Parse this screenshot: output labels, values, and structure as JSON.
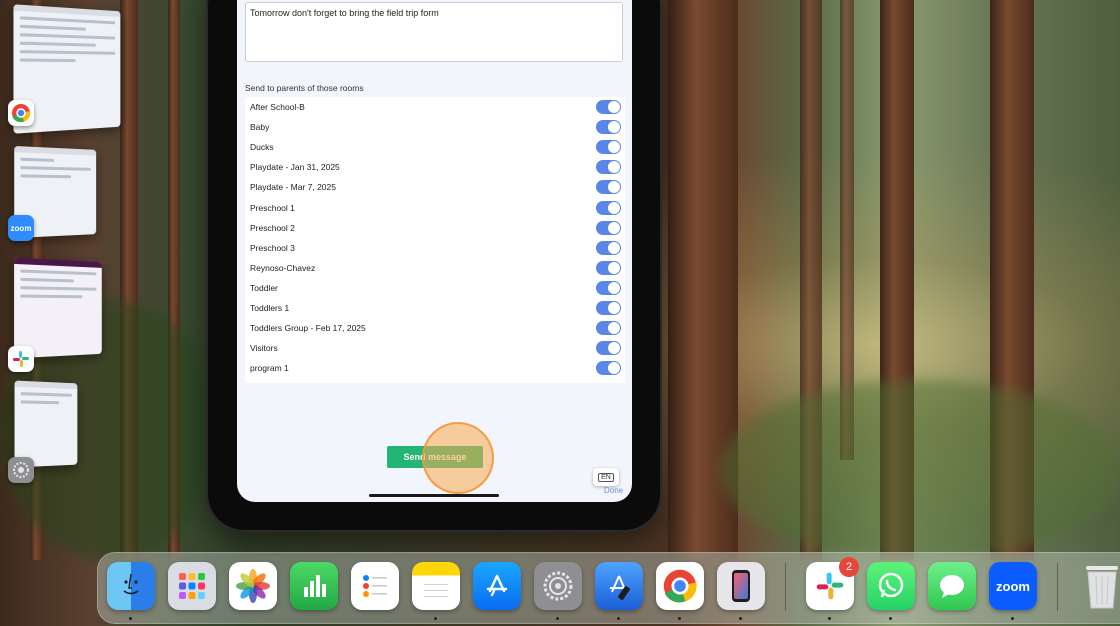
{
  "message": {
    "text": "Tomorrow don't forget to bring the field trip form",
    "section_label": "Send to parents of those rooms"
  },
  "rooms": [
    {
      "label": "After School-B",
      "on": true
    },
    {
      "label": "Baby",
      "on": true
    },
    {
      "label": "Ducks",
      "on": true
    },
    {
      "label": "Playdate - Jan 31, 2025",
      "on": true
    },
    {
      "label": "Playdate - Mar 7, 2025",
      "on": true
    },
    {
      "label": "Preschool 1",
      "on": true
    },
    {
      "label": "Preschool 2",
      "on": true
    },
    {
      "label": "Preschool 3",
      "on": true
    },
    {
      "label": "Reynoso-Chavez",
      "on": true
    },
    {
      "label": "Toddler",
      "on": true
    },
    {
      "label": "Toddlers 1",
      "on": true
    },
    {
      "label": "Toddlers Group - Feb 17, 2025",
      "on": true
    },
    {
      "label": "Visitors",
      "on": true
    },
    {
      "label": "program 1",
      "on": true
    }
  ],
  "actions": {
    "send_label": "Send message",
    "keyboard_lang": "EN",
    "done_label": "Done"
  },
  "stage_manager": {
    "apps": [
      "chrome-icon",
      "zoom-icon",
      "slack-icon",
      "system-settings-icon"
    ],
    "zoom_label": "zoom"
  },
  "dock": {
    "apps": [
      "finder-icon",
      "launchpad-icon",
      "photos-icon",
      "numbers-icon",
      "reminders-icon",
      "notes-icon",
      "app-store-icon",
      "system-settings-icon",
      "xcode-icon",
      "chrome-icon",
      "iphone-mirroring-icon",
      "slack-icon",
      "whatsapp-icon",
      "messages-icon",
      "zoom-icon",
      "trash-icon"
    ],
    "slack_badge": "2",
    "zoom_label": "zoom"
  },
  "colors": {
    "toggle_on": "#5a86e8",
    "send_button": "#22b573",
    "tap_indicator": "#f5963c"
  }
}
